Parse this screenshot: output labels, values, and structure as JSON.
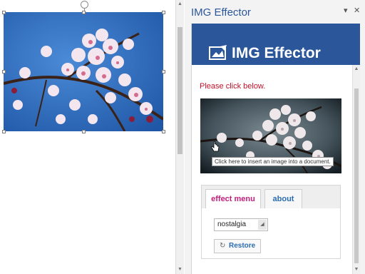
{
  "document": {
    "image_alt": "cherry-blossom-photo"
  },
  "task_pane": {
    "title": "IMG Effector",
    "menu_glyph": "▾",
    "close_glyph": "✕"
  },
  "addin": {
    "banner_title": "IMG Effector",
    "instruction": "Please click below.",
    "tooltip": "Click here to insert an image into a document.",
    "tabs": [
      {
        "label": "effect menu",
        "active": true
      },
      {
        "label": "about",
        "active": false
      }
    ],
    "effect_select": {
      "selected": "nostalgia"
    },
    "restore_label": "Restore",
    "restore_icon_glyph": "↻"
  },
  "colors": {
    "accent": "#2b579a",
    "instruction": "#c3102b",
    "active_tab": "#c41e7a",
    "link_tab": "#2b6cb0",
    "sky": "#2f6fc0"
  }
}
